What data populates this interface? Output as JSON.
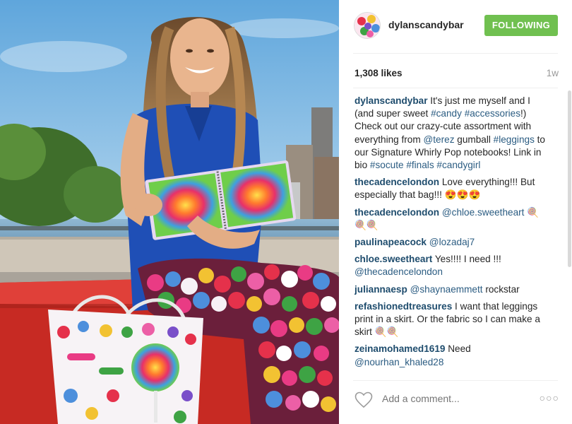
{
  "post": {
    "username": "dylanscandybar",
    "follow_label": "FOLLOWING",
    "likes": "1,308 likes",
    "age": "1w",
    "caption": [
      {
        "k": "u",
        "v": "dylanscandybar"
      },
      {
        "k": "t",
        "v": " It's just me myself and I (and super sweet "
      },
      {
        "k": "l",
        "v": "#candy"
      },
      {
        "k": "t",
        "v": " "
      },
      {
        "k": "l",
        "v": "#accessories"
      },
      {
        "k": "t",
        "v": "!) Check out our crazy-cute assortment with everything from "
      },
      {
        "k": "l",
        "v": "@terez"
      },
      {
        "k": "t",
        "v": " gumball "
      },
      {
        "k": "l",
        "v": "#leggings"
      },
      {
        "k": "t",
        "v": " to our Signature Whirly Pop notebooks! Link in bio "
      },
      {
        "k": "l",
        "v": "#socute"
      },
      {
        "k": "t",
        "v": " "
      },
      {
        "k": "l",
        "v": "#finals"
      },
      {
        "k": "t",
        "v": " "
      },
      {
        "k": "l",
        "v": "#candygirl"
      }
    ]
  },
  "comments": [
    {
      "user": "thecadencelondon",
      "parts": [
        {
          "k": "t",
          "v": "Love everything!!! But especially that bag!!! 😍😍😍"
        }
      ]
    },
    {
      "user": "thecadencelondon",
      "parts": [
        {
          "k": "l",
          "v": "@chloe.sweetheart"
        },
        {
          "k": "t",
          "v": " 🍭🍭🍭"
        }
      ]
    },
    {
      "user": "paulinapeacock",
      "parts": [
        {
          "k": "l",
          "v": "@lozadaj7"
        }
      ]
    },
    {
      "user": "chloe.sweetheart",
      "parts": [
        {
          "k": "t",
          "v": "Yes!!!! I need !!! "
        },
        {
          "k": "l",
          "v": "@thecadencelondon"
        }
      ]
    },
    {
      "user": "juliannaesp",
      "parts": [
        {
          "k": "l",
          "v": "@shaynaemmett"
        },
        {
          "k": "t",
          "v": " rockstar"
        }
      ]
    },
    {
      "user": "refashionedtreasures",
      "parts": [
        {
          "k": "t",
          "v": "I want that leggings print in a skirt. Or the fabric so I can make a skirt 🍭🍭"
        }
      ]
    },
    {
      "user": "zeinamohamed1619",
      "parts": [
        {
          "k": "t",
          "v": "Need "
        },
        {
          "k": "l",
          "v": "@nourhan_khaled28"
        }
      ]
    }
  ],
  "footer": {
    "add_comment_placeholder": "Add a comment...",
    "more_glyph": "○○○"
  },
  "icons": {
    "like": "heart-icon",
    "more": "more-options-icon",
    "avatar": "profile-avatar"
  },
  "colors": {
    "follow_button": "#70c050",
    "username": "#1e4c6d",
    "link": "#2b5c82",
    "muted": "#999999"
  }
}
